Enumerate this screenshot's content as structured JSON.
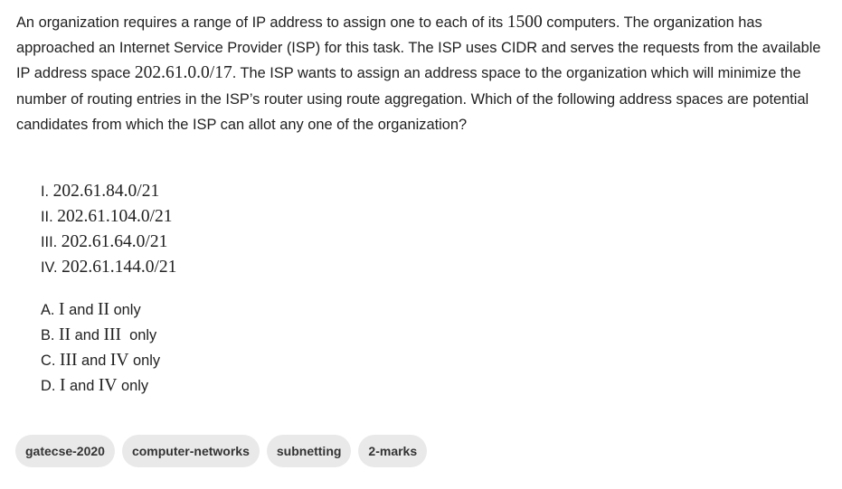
{
  "question": {
    "seg1": "An organization requires a range of IP address to assign one to each of its ",
    "count": "1500",
    "seg2": " computers. The organization has approached an Internet Service Provider (ISP) for this task. The ISP uses CIDR and serves the requests from the available IP address space ",
    "space": "202.61.0.0/17",
    "seg3": ". The ISP wants to assign an address space to the organization which will minimize the number of routing entries in the ISP’s router using route aggregation. Which of the following address spaces are potential candidates from which the ISP can allot any one of the organization?"
  },
  "statements": [
    {
      "label": "I. ",
      "value": "202.61.84.0/21"
    },
    {
      "label": "II. ",
      "value": "202.61.104.0/21"
    },
    {
      "label": "III. ",
      "value": "202.61.64.0/21"
    },
    {
      "label": "IV. ",
      "value": "202.61.144.0/21"
    }
  ],
  "options": [
    {
      "letter": "A. ",
      "a": "I",
      "and": " and ",
      "b": "II",
      "suffix": " only"
    },
    {
      "letter": "B. ",
      "a": "II",
      "and": " and ",
      "b": "III",
      "suffix": "  only"
    },
    {
      "letter": "C. ",
      "a": "III",
      "and": " and ",
      "b": "IV",
      "suffix": " only"
    },
    {
      "letter": "D. ",
      "a": "I",
      "and": " and ",
      "b": "IV",
      "suffix": " only"
    }
  ],
  "tags": [
    "gatecse-2020",
    "computer-networks",
    "subnetting",
    "2-marks"
  ]
}
